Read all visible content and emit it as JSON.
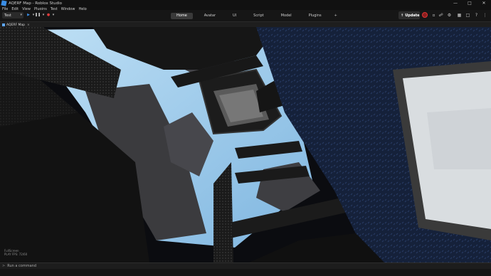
{
  "window": {
    "title": "AQERF Map - Roblox Studio",
    "controls": {
      "minimize": "—",
      "maximize": "□",
      "close": "✕"
    }
  },
  "menu": [
    "File",
    "Edit",
    "View",
    "Plugins",
    "Test",
    "Window",
    "Help"
  ],
  "toolbar": {
    "mode_select": "Test",
    "ribbon_tabs": [
      {
        "label": "Home",
        "active": true
      },
      {
        "label": "Avatar",
        "active": false
      },
      {
        "label": "UI",
        "active": false
      },
      {
        "label": "Script",
        "active": false
      },
      {
        "label": "Model",
        "active": false
      },
      {
        "label": "Plugins",
        "active": false
      }
    ],
    "more_tabs": "+",
    "update_label": "Update"
  },
  "document": {
    "tab_label": "AQERF Map"
  },
  "viewport": {
    "overlay_lines": [
      "FullScreen",
      "PLAY FPS: 72/60"
    ]
  },
  "command_bar": {
    "placeholder": "Run a command"
  },
  "colors": {
    "accent": "#3a8ee6",
    "record": "#e23b3b",
    "ice": "#8fc4e8"
  }
}
